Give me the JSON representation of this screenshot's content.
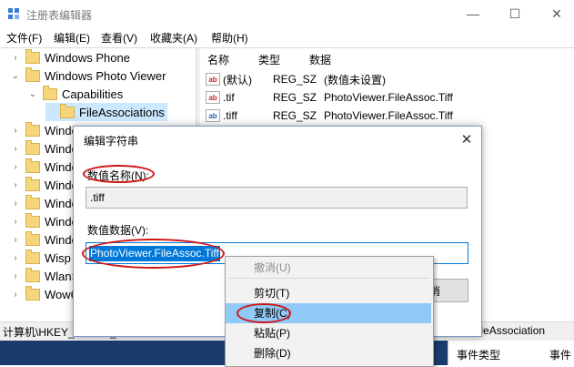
{
  "window": {
    "title": "注册表编辑器",
    "minimize": "—",
    "maximize": "☐",
    "close": "✕"
  },
  "menu": [
    "文件(F)",
    "编辑(E)",
    "查看(V)",
    "收藏夹(A)",
    "帮助(H)"
  ],
  "tree": [
    {
      "label": "Windows Phone",
      "arrow": "›"
    },
    {
      "label": "Windows Photo Viewer",
      "arrow": "⌄"
    },
    {
      "label": "Capabilities",
      "arrow": "⌄"
    },
    {
      "label": "FileAssociations",
      "arrow": ""
    },
    {
      "label": "Windo",
      "arrow": "›"
    },
    {
      "label": "Windo",
      "arrow": "›"
    },
    {
      "label": "Windo",
      "arrow": "›"
    },
    {
      "label": "Windo",
      "arrow": "›"
    },
    {
      "label": "Windo",
      "arrow": "›"
    },
    {
      "label": "Windo",
      "arrow": "›"
    },
    {
      "label": "Windo",
      "arrow": "›"
    },
    {
      "label": "Wisp",
      "arrow": "›"
    },
    {
      "label": "WlanS",
      "arrow": "›"
    },
    {
      "label": "Wow6",
      "arrow": "›"
    }
  ],
  "list": {
    "headers": [
      "名称",
      "类型",
      "数据"
    ],
    "rows": [
      {
        "icon": "ab",
        "name": "(默认)",
        "type": "REG_SZ",
        "data": "(数值未设置)"
      },
      {
        "icon": "ab",
        "name": ".tif",
        "type": "REG_SZ",
        "data": "PhotoViewer.FileAssoc.Tiff"
      },
      {
        "icon": "ab",
        "name": ".tiff",
        "type": "REG_SZ",
        "data": "PhotoViewer.FileAssoc.Tiff"
      }
    ]
  },
  "status": {
    "path": "计算机\\HKEY_LOCAL_MACHINE\\SOFTWAR",
    "tail": "abilities\\FileAssociation"
  },
  "bottom_panel": {
    "col1": "事件类型",
    "col2": "事件"
  },
  "dialog": {
    "title": "编辑字符串",
    "close": "✕",
    "name_label": "数值名称(N):",
    "name_value": ".tiff",
    "data_label": "数值数据(V):",
    "data_value": "PhotoViewer.FileAssoc.Tiff",
    "ok_partial": "消"
  },
  "context_menu": {
    "items": [
      {
        "label": "撤消(U)",
        "enabled": false
      },
      {
        "label": "剪切(T)",
        "enabled": true
      },
      {
        "label": "复制(C)",
        "enabled": true,
        "highlighted": true
      },
      {
        "label": "粘贴(P)",
        "enabled": true
      },
      {
        "label": "删除(D)",
        "enabled": true
      }
    ]
  },
  "colors": {
    "accent": "#0078d7",
    "annotation": "#d01414",
    "menu_hover": "#91c9f7",
    "tree_selected": "#cce8ff"
  }
}
